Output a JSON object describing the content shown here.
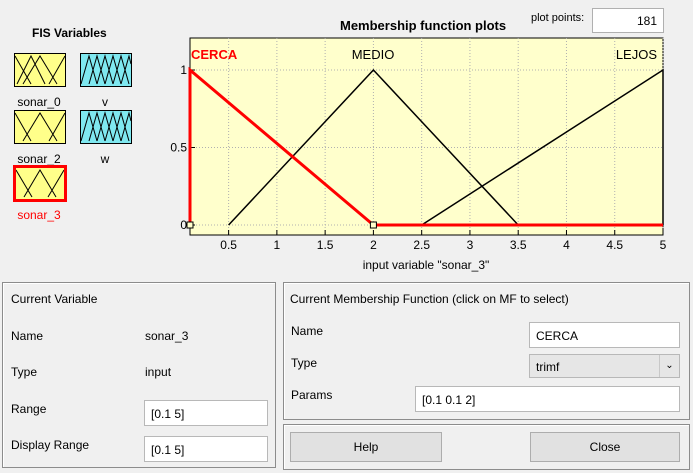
{
  "fis_variables": {
    "title": "FIS Variables",
    "items": [
      {
        "label": "sonar_0",
        "kind": "input",
        "selected": false
      },
      {
        "label": "v",
        "kind": "output",
        "selected": false
      },
      {
        "label": "sonar_2",
        "kind": "input",
        "selected": false
      },
      {
        "label": "w",
        "kind": "output",
        "selected": false
      },
      {
        "label": "sonar_3",
        "kind": "input",
        "selected": true
      }
    ]
  },
  "plot": {
    "title": "Membership function plots",
    "plot_points_label": "plot points:",
    "plot_points_value": "181",
    "xlabel": "input variable \"sonar_3\"",
    "x_ticks": [
      "0.5",
      "1",
      "1.5",
      "2",
      "2.5",
      "3",
      "3.5",
      "4",
      "4.5",
      "5"
    ],
    "y_ticks": [
      "0",
      "0.5",
      "1"
    ],
    "mf_labels": {
      "cerca": "CERCA",
      "medio": "MEDIO",
      "lejos": "LEJOS"
    },
    "colors": {
      "background": "#ffffcc",
      "selected_mf": "#ff0000",
      "mf": "#000000"
    }
  },
  "chart_data": {
    "type": "line",
    "x_range": [
      0.1,
      5
    ],
    "ylim": [
      0,
      1
    ],
    "series": [
      {
        "name": "CERCA",
        "x": [
          0.1,
          0.1,
          2
        ],
        "y": [
          0,
          1,
          0
        ]
      },
      {
        "name": "MEDIO",
        "x": [
          0.5,
          2,
          3.5
        ],
        "y": [
          0,
          1,
          0
        ]
      },
      {
        "name": "LEJOS",
        "x": [
          2.5,
          5,
          5
        ],
        "y": [
          0,
          1,
          0
        ]
      }
    ]
  },
  "current_variable": {
    "title": "Current Variable",
    "name_label": "Name",
    "name_value": "sonar_3",
    "type_label": "Type",
    "type_value": "input",
    "range_label": "Range",
    "range_value": "[0.1 5]",
    "display_range_label": "Display Range",
    "display_range_value": "[0.1 5]"
  },
  "current_mf": {
    "title": "Current Membership Function (click on MF to select)",
    "name_label": "Name",
    "name_value": "CERCA",
    "type_label": "Type",
    "type_value": "trimf",
    "params_label": "Params",
    "params_value": "[0.1 0.1 2]"
  },
  "buttons": {
    "help": "Help",
    "close": "Close"
  }
}
